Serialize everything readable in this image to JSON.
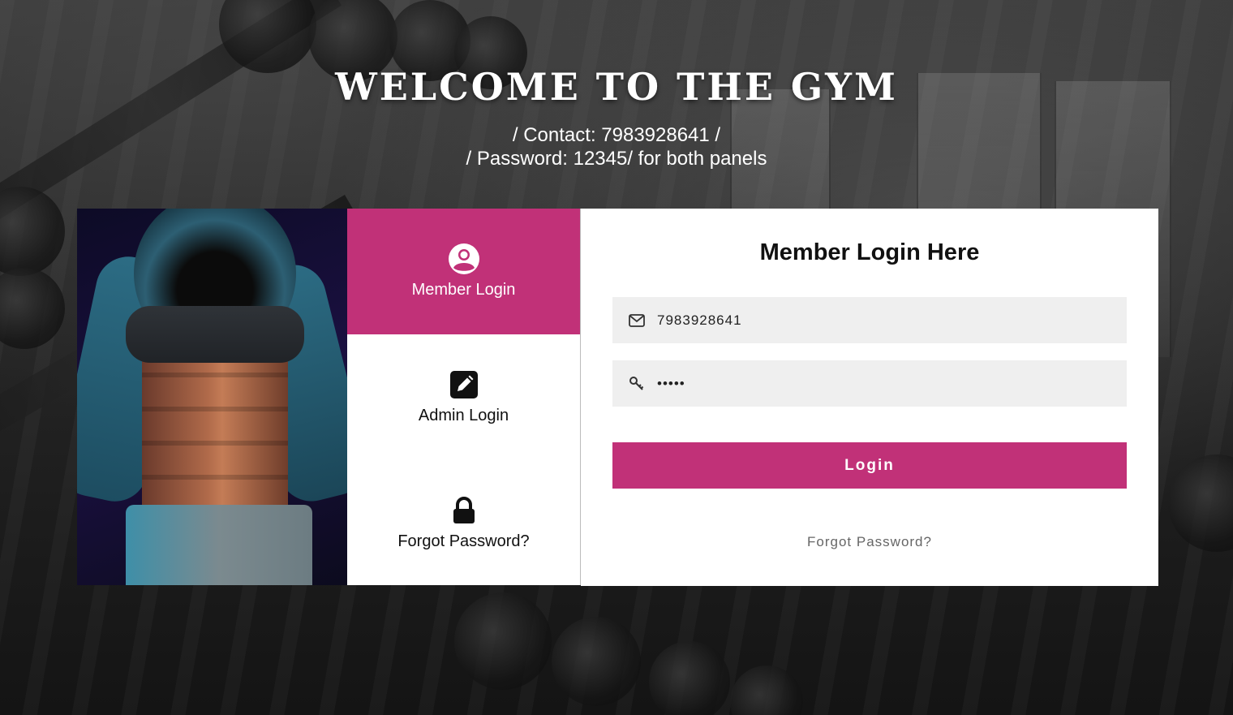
{
  "header": {
    "title": "WELCOME TO THE GYM",
    "contact_line": "/ Contact: 7983928641 /",
    "password_line": "/ Password: 12345/ for both panels"
  },
  "menu": {
    "items": [
      {
        "label": "Member Login",
        "icon": "user-circle-icon",
        "active": true
      },
      {
        "label": "Admin Login",
        "icon": "edit-icon",
        "active": false
      },
      {
        "label": "Forgot Password?",
        "icon": "lock-icon",
        "active": false
      }
    ]
  },
  "form": {
    "title": "Member Login Here",
    "contact_value": "7983928641",
    "password_value": "12345",
    "login_label": "Login",
    "forgot_label": "Forgot Password?"
  },
  "colors": {
    "accent": "#c13178",
    "field_bg": "#efefef"
  }
}
